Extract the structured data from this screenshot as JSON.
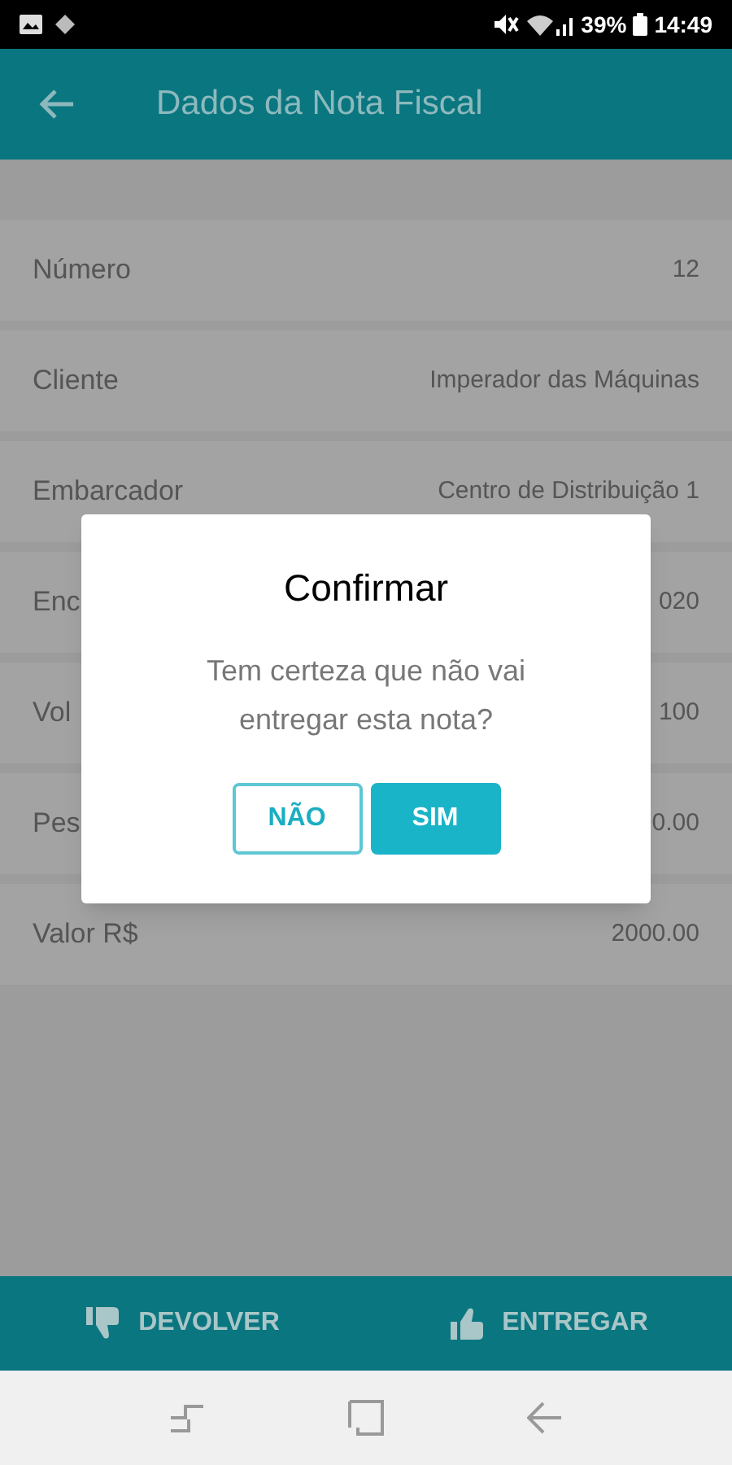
{
  "status_bar": {
    "battery": "39%",
    "time": "14:49"
  },
  "app_bar": {
    "title": "Dados da Nota Fiscal"
  },
  "fields": [
    {
      "label": "Número",
      "value": "12"
    },
    {
      "label": "Cliente",
      "value": "Imperador das Máquinas"
    },
    {
      "label": "Embarcador",
      "value": "Centro de Distribuição 1"
    },
    {
      "label": "Enc",
      "value": "020"
    },
    {
      "label": "Vol",
      "value": "100"
    },
    {
      "label": "Pes",
      "value": "0.00"
    },
    {
      "label": "Valor R$",
      "value": "2000.00"
    }
  ],
  "dialog": {
    "title": "Confirmar",
    "message": "Tem certeza que não vai entregar esta nota?",
    "buttons": [
      {
        "label": "NÃO",
        "kind": "outline"
      },
      {
        "label": "SIM",
        "kind": "primary"
      }
    ]
  },
  "bottom_actions": [
    {
      "label": "DEVOLVER",
      "kind": "reject"
    },
    {
      "label": "ENTREGAR",
      "kind": "accept"
    }
  ]
}
